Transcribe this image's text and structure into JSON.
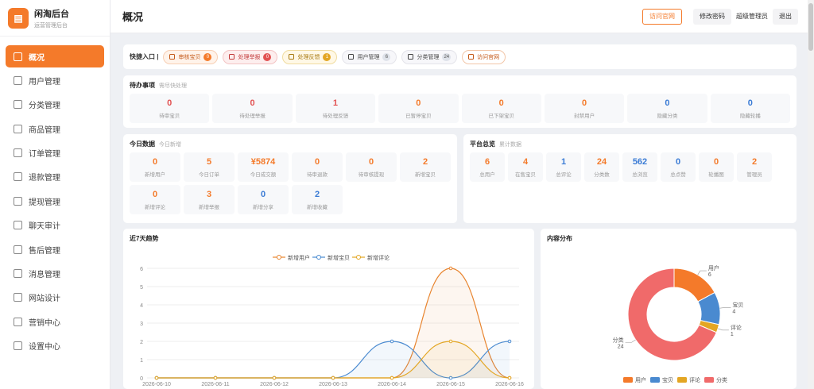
{
  "brand": {
    "title": "闲淘后台",
    "subtitle": "运营管理后台",
    "logo_icon": "shop-icon"
  },
  "sidebar": {
    "items": [
      {
        "label": "概况",
        "icon": "dashboard-icon",
        "active": true
      },
      {
        "label": "用户管理",
        "icon": "users-icon"
      },
      {
        "label": "分类管理",
        "icon": "grid-icon"
      },
      {
        "label": "商品管理",
        "icon": "product-icon"
      },
      {
        "label": "订单管理",
        "icon": "order-icon"
      },
      {
        "label": "退款管理",
        "icon": "flag-icon"
      },
      {
        "label": "提现管理",
        "icon": "card-icon"
      },
      {
        "label": "聊天审计",
        "icon": "flag-icon"
      },
      {
        "label": "售后管理",
        "icon": "chat-icon"
      },
      {
        "label": "消息管理",
        "icon": "message-icon"
      },
      {
        "label": "网站设计",
        "icon": "layout-icon"
      },
      {
        "label": "营销中心",
        "icon": "mic-icon"
      },
      {
        "label": "设置中心",
        "icon": "gear-icon"
      }
    ]
  },
  "header": {
    "title": "概况",
    "visit_site": "访问官网",
    "change_password": "修改密码",
    "user": "超级管理员",
    "logout": "退出"
  },
  "quick": {
    "label": "快捷入口 |",
    "items": [
      {
        "label": "审核宝贝",
        "badge": "0",
        "style": "c1",
        "badge_style": "o"
      },
      {
        "label": "处理举报",
        "badge": "0",
        "style": "c2",
        "badge_style": "r"
      },
      {
        "label": "处理反馈",
        "badge": "1",
        "style": "c3",
        "badge_style": "y"
      },
      {
        "label": "用户管理",
        "badge": "6",
        "style": "c4",
        "badge_style": "g"
      },
      {
        "label": "分类管理",
        "badge": "24",
        "style": "c5",
        "badge_style": "g"
      },
      {
        "label": "访问官网",
        "badge": "",
        "style": "c6",
        "badge_style": ""
      }
    ]
  },
  "pending": {
    "title": "待办事项",
    "subtitle": "需尽快处理",
    "items": [
      {
        "value": "0",
        "label": "待审宝贝",
        "color": "vr"
      },
      {
        "value": "0",
        "label": "待处理举报",
        "color": "vr"
      },
      {
        "value": "1",
        "label": "待处理反馈",
        "color": "vr"
      },
      {
        "value": "0",
        "label": "已暂停宝贝",
        "color": "vo"
      },
      {
        "value": "0",
        "label": "已下架宝贝",
        "color": "vo"
      },
      {
        "value": "0",
        "label": "封禁用户",
        "color": "vo"
      },
      {
        "value": "0",
        "label": "隐藏分类",
        "color": "vb"
      },
      {
        "value": "0",
        "label": "隐藏轮播",
        "color": "vb"
      }
    ]
  },
  "today": {
    "title": "今日数据",
    "subtitle": "今日新增",
    "items": [
      {
        "value": "0",
        "label": "新增用户",
        "color": "vo"
      },
      {
        "value": "5",
        "label": "今日订单",
        "color": "vo"
      },
      {
        "value": "¥5874",
        "label": "今日成交额",
        "color": "vo"
      },
      {
        "value": "0",
        "label": "待审退款",
        "color": "vo"
      },
      {
        "value": "0",
        "label": "待审核提现",
        "color": "vo"
      },
      {
        "value": "2",
        "label": "新增宝贝",
        "color": "vo"
      },
      {
        "value": "0",
        "label": "新增评论",
        "color": "vo"
      },
      {
        "value": "3",
        "label": "新增举报",
        "color": "vo"
      },
      {
        "value": "0",
        "label": "新增分享",
        "color": "vb"
      },
      {
        "value": "2",
        "label": "新增收藏",
        "color": "vb"
      }
    ]
  },
  "overview": {
    "title": "平台总览",
    "subtitle": "累计数据",
    "items": [
      {
        "value": "6",
        "label": "总用户",
        "color": "vo"
      },
      {
        "value": "4",
        "label": "在售宝贝",
        "color": "vo"
      },
      {
        "value": "1",
        "label": "总评论",
        "color": "vb"
      },
      {
        "value": "24",
        "label": "分类数",
        "color": "vo"
      },
      {
        "value": "562",
        "label": "总浏览",
        "color": "vb"
      },
      {
        "value": "0",
        "label": "总点赞",
        "color": "vb"
      },
      {
        "value": "0",
        "label": "轮播图",
        "color": "vo"
      },
      {
        "value": "2",
        "label": "管理员",
        "color": "vo"
      }
    ]
  },
  "chart_data": [
    {
      "type": "line",
      "title": "近7天趋势",
      "categories": [
        "2026-06-10",
        "2026-06-11",
        "2026-06-12",
        "2026-06-13",
        "2026-06-14",
        "2026-06-15",
        "2026-06-16"
      ],
      "ylim": [
        0,
        6
      ],
      "yticks": [
        "0",
        "1",
        "2",
        "3",
        "4",
        "5",
        "6"
      ],
      "series": [
        {
          "name": "新增用户",
          "color": "#e8842e",
          "values": [
            0,
            0,
            0,
            0,
            0,
            6,
            0
          ]
        },
        {
          "name": "新增宝贝",
          "color": "#4a8ad0",
          "values": [
            0,
            0,
            0,
            0,
            2,
            0,
            2
          ]
        },
        {
          "name": "新增评论",
          "color": "#e3a623",
          "values": [
            0,
            0,
            0,
            0,
            0,
            2,
            0
          ]
        }
      ],
      "legend": "top-center"
    },
    {
      "type": "pie",
      "title": "内容分布",
      "categories": [
        "用户",
        "宝贝",
        "评论",
        "分类"
      ],
      "values": [
        6,
        4,
        1,
        24
      ],
      "labels": [
        "用户\n6",
        "宝贝\n4",
        "评论\n1",
        "分类\n24"
      ],
      "colors": [
        "#f47a2a",
        "#4a8ad0",
        "#e3a623",
        "#f06a6a"
      ],
      "legend": "bottom-center"
    }
  ]
}
